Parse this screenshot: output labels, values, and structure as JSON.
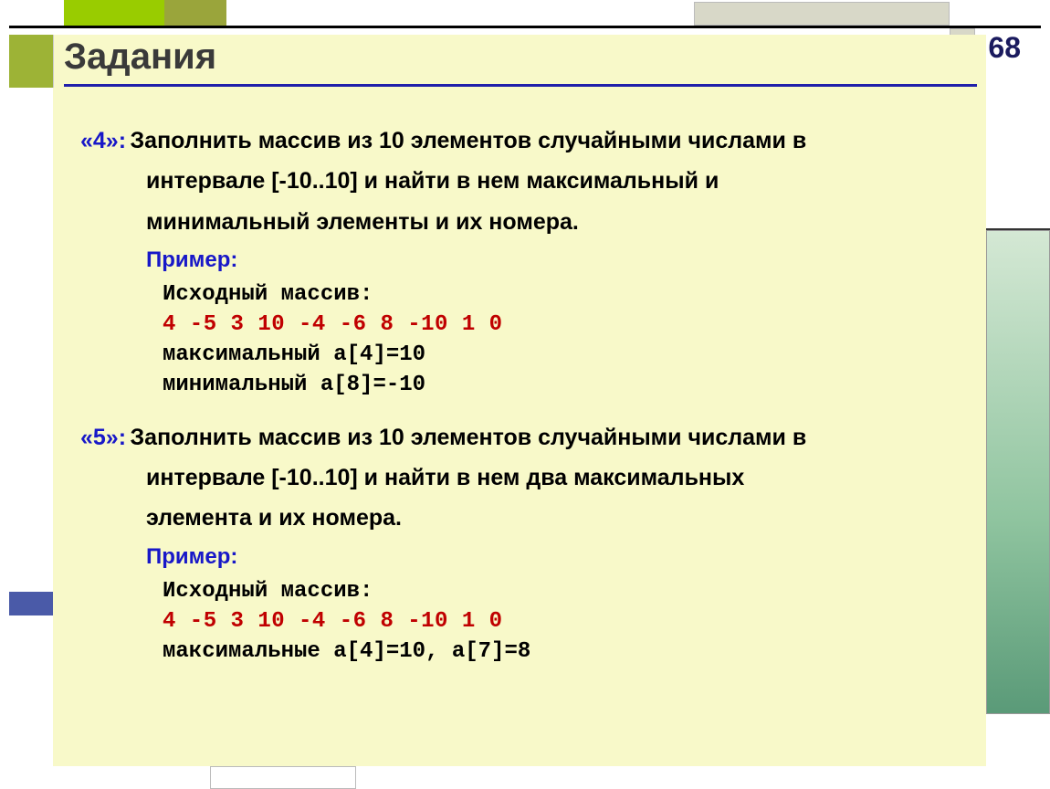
{
  "page_number": "68",
  "title": "Задания",
  "task4": {
    "grade": "«4»:",
    "text_line1": "Заполнить  массив из 10 элементов случайными числами в",
    "text_line2": "интервале [-10..10] и найти в нем максимальный и",
    "text_line3": "минимальный элементы и их номера.",
    "example_label": "Пример:",
    "src_label": "Исходный массив:",
    "array": "4   -5   3  10  -4  -6  8  -10  1  0",
    "max_line": "максимальный a[4]=10",
    "min_line": "минимальный  a[8]=-10"
  },
  "task5": {
    "grade": "«5»:",
    "text_line1": "Заполнить  массив из 10 элементов случайными числами в",
    "text_line2": "интервале [-10..10] и найти в нем два максимальных",
    "text_line3": "элемента и их номера.",
    "example_label": "Пример:",
    "src_label": "Исходный массив:",
    "array": "4   -5   3  10  -4  -6  8  -10  1  0",
    "max_line": "максимальные a[4]=10, a[7]=8"
  }
}
